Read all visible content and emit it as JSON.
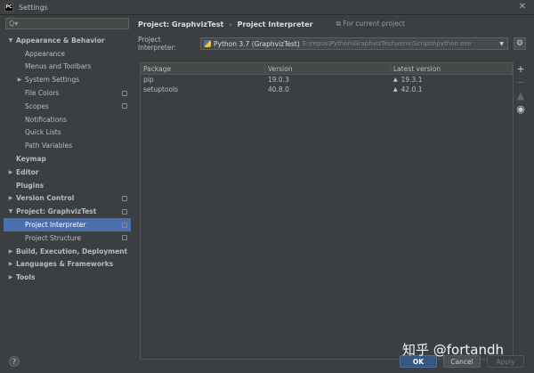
{
  "window": {
    "title": "Settings",
    "app_icon": "PC"
  },
  "search": {
    "icon": "search-icon",
    "placeholder": "Q▾"
  },
  "sidebar": {
    "items": [
      {
        "label": "Appearance & Behavior",
        "arrow": "▼",
        "indent": 0,
        "bold": true,
        "copy": false
      },
      {
        "label": "Appearance",
        "arrow": "",
        "indent": 1,
        "bold": false,
        "copy": false
      },
      {
        "label": "Menus and Toolbars",
        "arrow": "",
        "indent": 1,
        "bold": false,
        "copy": false
      },
      {
        "label": "System Settings",
        "arrow": "▶",
        "indent": 1,
        "bold": false,
        "copy": false
      },
      {
        "label": "File Colors",
        "arrow": "",
        "indent": 1,
        "bold": false,
        "copy": true
      },
      {
        "label": "Scopes",
        "arrow": "",
        "indent": 1,
        "bold": false,
        "copy": true
      },
      {
        "label": "Notifications",
        "arrow": "",
        "indent": 1,
        "bold": false,
        "copy": false
      },
      {
        "label": "Quick Lists",
        "arrow": "",
        "indent": 1,
        "bold": false,
        "copy": false
      },
      {
        "label": "Path Variables",
        "arrow": "",
        "indent": 1,
        "bold": false,
        "copy": false
      },
      {
        "label": "Keymap",
        "arrow": "",
        "indent": 0,
        "bold": true,
        "copy": false
      },
      {
        "label": "Editor",
        "arrow": "▶",
        "indent": 0,
        "bold": true,
        "copy": false
      },
      {
        "label": "Plugins",
        "arrow": "",
        "indent": 0,
        "bold": true,
        "copy": false
      },
      {
        "label": "Version Control",
        "arrow": "▶",
        "indent": 0,
        "bold": true,
        "copy": true
      },
      {
        "label": "Project: GraphvizTest",
        "arrow": "▼",
        "indent": 0,
        "bold": true,
        "copy": true
      },
      {
        "label": "Project Interpreter",
        "arrow": "",
        "indent": 1,
        "bold": false,
        "copy": true,
        "selected": true
      },
      {
        "label": "Project Structure",
        "arrow": "",
        "indent": 1,
        "bold": false,
        "copy": true
      },
      {
        "label": "Build, Execution, Deployment",
        "arrow": "▶",
        "indent": 0,
        "bold": true,
        "copy": false
      },
      {
        "label": "Languages & Frameworks",
        "arrow": "▶",
        "indent": 0,
        "bold": true,
        "copy": false
      },
      {
        "label": "Tools",
        "arrow": "▶",
        "indent": 0,
        "bold": true,
        "copy": false
      }
    ]
  },
  "breadcrumb": {
    "project": "Project: GraphvizTest",
    "separator": "›",
    "page": "Project Interpreter",
    "scope_note": "For current project"
  },
  "interpreter": {
    "label": "Project Interpreter:",
    "name": "Python 3.7 (GraphvizTest)",
    "path": "E:\\repos\\Python\\GraphvizTest\\venv\\Scripts\\python.exe"
  },
  "packages": {
    "headers": [
      "Package",
      "Version",
      "Latest version"
    ],
    "rows": [
      {
        "package": "pip",
        "version": "19.0.3",
        "latest": "19.3.1"
      },
      {
        "package": "setuptools",
        "version": "40.8.0",
        "latest": "42.0.1"
      }
    ]
  },
  "tools": [
    "+",
    "−",
    "▲",
    "◉"
  ],
  "footer": {
    "help": "?",
    "ok": "OK",
    "cancel": "Cancel",
    "apply": "Apply"
  },
  "watermark": "知乎 @fortandh"
}
